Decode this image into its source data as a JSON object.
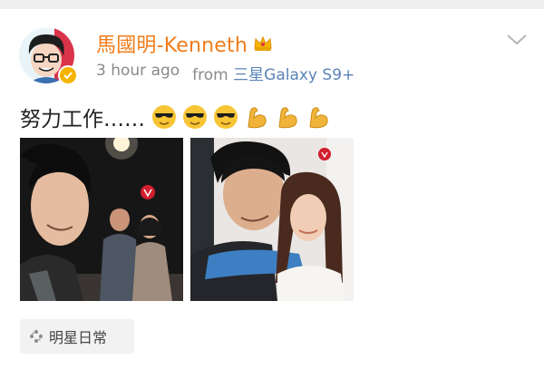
{
  "post": {
    "author_name": "馬國明-Kenneth",
    "time_ago": "3 hour ago",
    "source_prefix": "from",
    "source_device": "三星Galaxy S9+",
    "text": "努力工作……",
    "emojis": [
      "cool-face",
      "cool-face",
      "cool-face",
      "flexed-biceps",
      "flexed-biceps",
      "flexed-biceps"
    ],
    "tag_label": "明星日常"
  },
  "colors": {
    "author": "#f07c1a",
    "source": "#5a84b8",
    "meta": "#8a8a8a",
    "verified": "#f5b400"
  },
  "icons": {
    "verified": "verified-badge-icon",
    "crown": "crown-icon",
    "more": "chevron-down-icon",
    "tag": "sparkle-icon"
  }
}
